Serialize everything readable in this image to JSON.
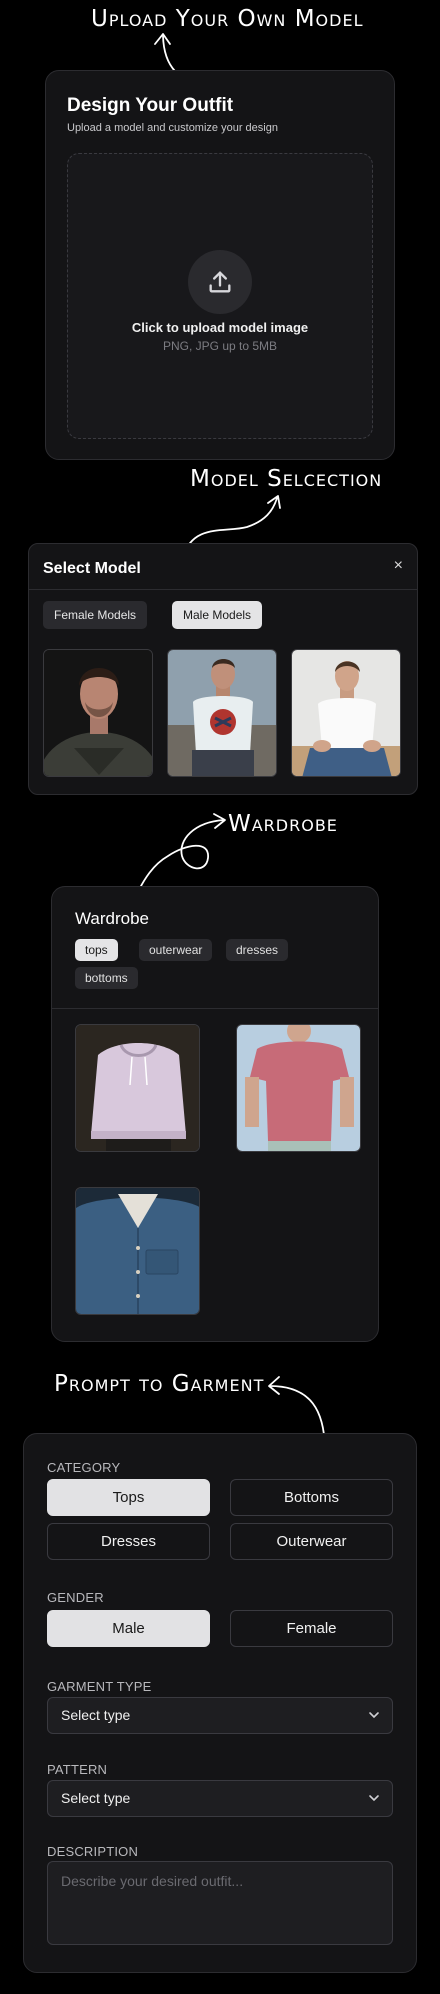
{
  "annotations": {
    "upload": "Upload Your Own Model",
    "selection": "Model Selcection",
    "wardrobe": "Wardrobe",
    "prompt": "Prompt to Garment"
  },
  "upload_card": {
    "title": "Design Your Outfit",
    "subtitle": "Upload a model and customize your design",
    "dropzone_text": "Click to upload model image",
    "dropzone_hint": "PNG, JPG up to 5MB",
    "icon": "upload-icon"
  },
  "model_card": {
    "title": "Select Model",
    "close": "×",
    "tabs": [
      {
        "label": "Female Models",
        "active": false
      },
      {
        "label": "Male Models",
        "active": true
      }
    ],
    "thumbnails": [
      "model-photo-sweater",
      "model-photo-graphic-tee",
      "model-photo-white-tee"
    ]
  },
  "wardrobe_card": {
    "title": "Wardrobe",
    "chips": [
      {
        "label": "tops",
        "active": true
      },
      {
        "label": "outerwear",
        "active": false
      },
      {
        "label": "dresses",
        "active": false
      },
      {
        "label": "bottoms",
        "active": false
      }
    ],
    "items": [
      "lavender-hoodie",
      "pink-tshirt",
      "blue-denim-shirt"
    ]
  },
  "garment_card": {
    "category_label": "CATEGORY",
    "categories": [
      {
        "label": "Tops",
        "active": true
      },
      {
        "label": "Bottoms",
        "active": false
      },
      {
        "label": "Dresses",
        "active": false
      },
      {
        "label": "Outerwear",
        "active": false
      }
    ],
    "gender_label": "GENDER",
    "genders": [
      {
        "label": "Male",
        "active": true
      },
      {
        "label": "Female",
        "active": false
      }
    ],
    "garment_type_label": "GARMENT TYPE",
    "garment_type_value": "Select type",
    "pattern_label": "PATTERN",
    "pattern_value": "Select type",
    "description_label": "DESCRIPTION",
    "description_placeholder": "Describe your desired outfit..."
  },
  "colors": {
    "background": "#000000",
    "card": "#141416",
    "active": "#e4e4e6",
    "border": "#2c2c30"
  }
}
